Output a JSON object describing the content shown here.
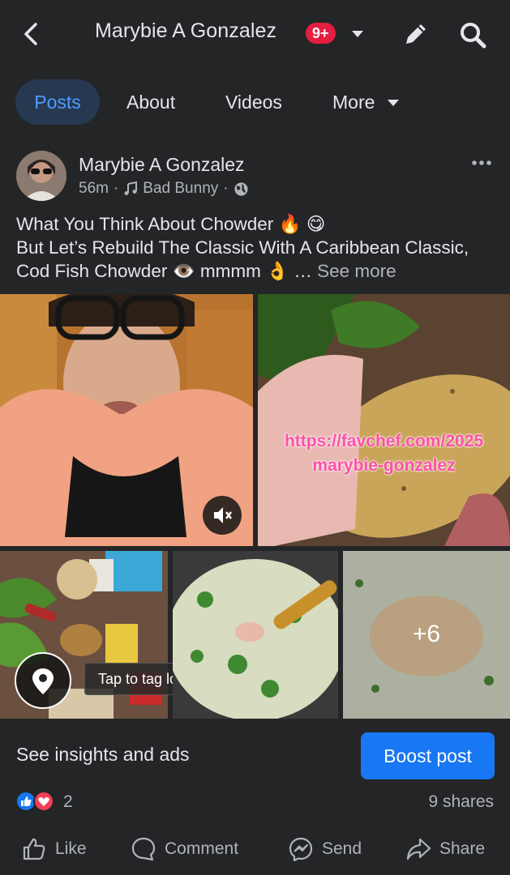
{
  "header": {
    "title": "Marybie A Gonzalez",
    "badge": "9+"
  },
  "tabs": [
    {
      "label": "Posts",
      "active": true
    },
    {
      "label": "About"
    },
    {
      "label": "Videos"
    },
    {
      "label": "More"
    }
  ],
  "post": {
    "author": "Marybie A Gonzalez",
    "time": "56m",
    "music": "Bad Bunny",
    "caption_line1": "What You Think About Chowder 🔥 😋",
    "caption_line2": "But Let’s Rebuild The Classic With A Caribbean Classic, Cod Fish Chowder 👁️ mmmm 👌 …",
    "see_more": "See more",
    "overlay_url_line1": "https://favchef.com/2025",
    "overlay_url_line2": "marybie-gonzalez",
    "more_photos": "+6",
    "location_tip": "Tap to tag location",
    "insights": "See insights and ads",
    "boost": "Boost post",
    "reaction_count": "2",
    "shares": "9 shares",
    "actions": {
      "like": "Like",
      "comment": "Comment",
      "send": "Send",
      "share": "Share"
    }
  },
  "colors": {
    "background": "#242526",
    "accent": "#1877f2",
    "badge": "#e41e3f",
    "active_tab_bg": "#263951"
  },
  "icons": [
    "back-arrow-icon",
    "chevron-down-icon",
    "pencil-icon",
    "search-icon",
    "more-dots-icon",
    "music-note-icon",
    "globe-icon",
    "mute-icon",
    "location-pin-icon",
    "like-reaction-icon",
    "love-reaction-icon",
    "thumbs-up-icon",
    "comment-icon",
    "messenger-icon",
    "share-icon"
  ]
}
